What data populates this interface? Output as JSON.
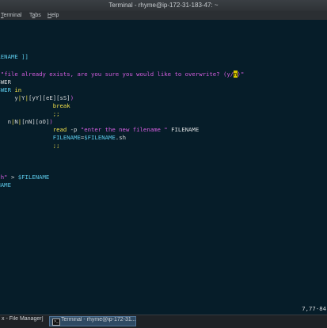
{
  "window": {
    "title": "Terminal - rhyme@ip-172-31-183-47: ~",
    "menu": [
      {
        "label": "Terminal",
        "mnemonic": "T"
      },
      {
        "label": "Tabs",
        "mnemonic": "a"
      },
      {
        "label": "Help",
        "mnemonic": "H"
      }
    ]
  },
  "colors": {
    "background": "#061d29",
    "text": "#d7dadc",
    "keyword": "#f2e04a",
    "string": "#d55ee0",
    "variable": "#5bc8e8",
    "bracket": "#e0e0e0"
  },
  "editor": {
    "lines": [
      [
        {
          "t": "ILENAME ]]",
          "c": "variable"
        }
      ],
      [
        {
          "t": "n ",
          "c": "keyword"
        },
        {
          "t": "\"file already exists, are you sure you would like to overwrite? (y/",
          "c": "string"
        },
        {
          "t": "n",
          "c": "cursor"
        },
        {
          "t": ")\"",
          "c": "string"
        }
      ],
      [
        {
          "t": "NSWER",
          "c": "text"
        }
      ],
      [
        {
          "t": "NSWER ",
          "c": "variable"
        },
        {
          "t": "in",
          "c": "keyword"
        }
      ],
      [
        {
          "t": "      y",
          "c": "text"
        },
        {
          "t": "|",
          "c": "keyword"
        },
        {
          "t": "Y",
          "c": "text"
        },
        {
          "t": "|",
          "c": "keyword"
        },
        {
          "t": "[yY][eE][sS]",
          "c": "text"
        },
        {
          "t": ")",
          "c": "string"
        }
      ],
      [
        {
          "t": "                 ",
          "c": "text"
        },
        {
          "t": "break",
          "c": "keyword"
        }
      ],
      [
        {
          "t": "                 ",
          "c": "text"
        },
        {
          "t": ";;",
          "c": "keyword"
        }
      ],
      [
        {
          "t": "    n",
          "c": "text"
        },
        {
          "t": "|",
          "c": "keyword"
        },
        {
          "t": "N",
          "c": "text"
        },
        {
          "t": "|",
          "c": "keyword"
        },
        {
          "t": "[nN][oO]",
          "c": "text"
        },
        {
          "t": ")",
          "c": "string"
        }
      ],
      [
        {
          "t": "                 ",
          "c": "text"
        },
        {
          "t": "read ",
          "c": "keyword"
        },
        {
          "t": "-p ",
          "c": "text"
        },
        {
          "t": "\"enter the new filename \"",
          "c": "string"
        },
        {
          "t": " FILENAME",
          "c": "text"
        }
      ],
      [
        {
          "t": "                 ",
          "c": "text"
        },
        {
          "t": "FILENAME",
          "c": "variable"
        },
        {
          "t": "=",
          "c": "text"
        },
        {
          "t": "$FILENAME",
          "c": "variable"
        },
        {
          "t": ".sh",
          "c": "text"
        }
      ],
      [
        {
          "t": "                 ",
          "c": "text"
        },
        {
          "t": ";;",
          "c": "keyword"
        }
      ],
      [
        {
          "t": "",
          "c": "text"
        }
      ],
      [
        {
          "t": "",
          "c": "text"
        }
      ],
      [
        {
          "t": "",
          "c": "text"
        }
      ],
      [
        {
          "t": "ash\"",
          "c": "string"
        },
        {
          "t": " > ",
          "c": "text"
        },
        {
          "t": "$FILENAME",
          "c": "variable"
        }
      ],
      [
        {
          "t": "ENAME",
          "c": "variable"
        }
      ]
    ],
    "status_position": "7,77-84"
  },
  "taskbar": {
    "items": [
      {
        "label": "x - File Manager]"
      },
      {
        "label": "Terminal - rhyme@ip-172-31..."
      }
    ]
  }
}
